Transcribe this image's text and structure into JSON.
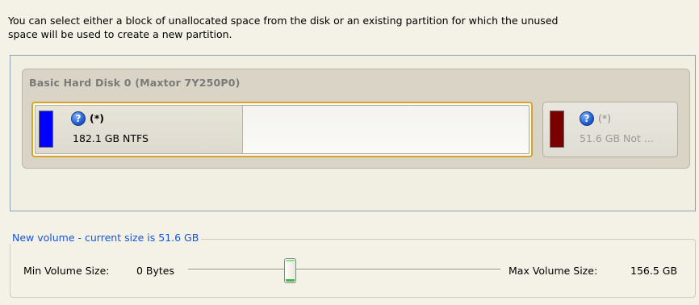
{
  "instructions": {
    "line1": "You can select either a block of unallocated space from the disk or an existing partition for which the unused",
    "line2": "space will be used to create a new partition."
  },
  "disk": {
    "title": "Basic Hard Disk 0 (Maxtor 7Y250P0)",
    "partitions": [
      {
        "letter": "(*)",
        "description": "182.1 GB NTFS",
        "color": "#0000ff",
        "selected": true,
        "used_fraction": 0.42
      },
      {
        "letter": "(*)",
        "description": "51.6 GB Not ...",
        "color": "#7a0000",
        "selected": false
      }
    ]
  },
  "new_volume": {
    "legend": "New volume - current size is 51.6 GB",
    "min_label": "Min Volume Size:",
    "min_value": "0 Bytes",
    "max_label": "Max Volume Size:",
    "max_value": "156.5 GB",
    "slider_fraction": 0.33
  },
  "icons": {
    "help": "help-icon"
  }
}
